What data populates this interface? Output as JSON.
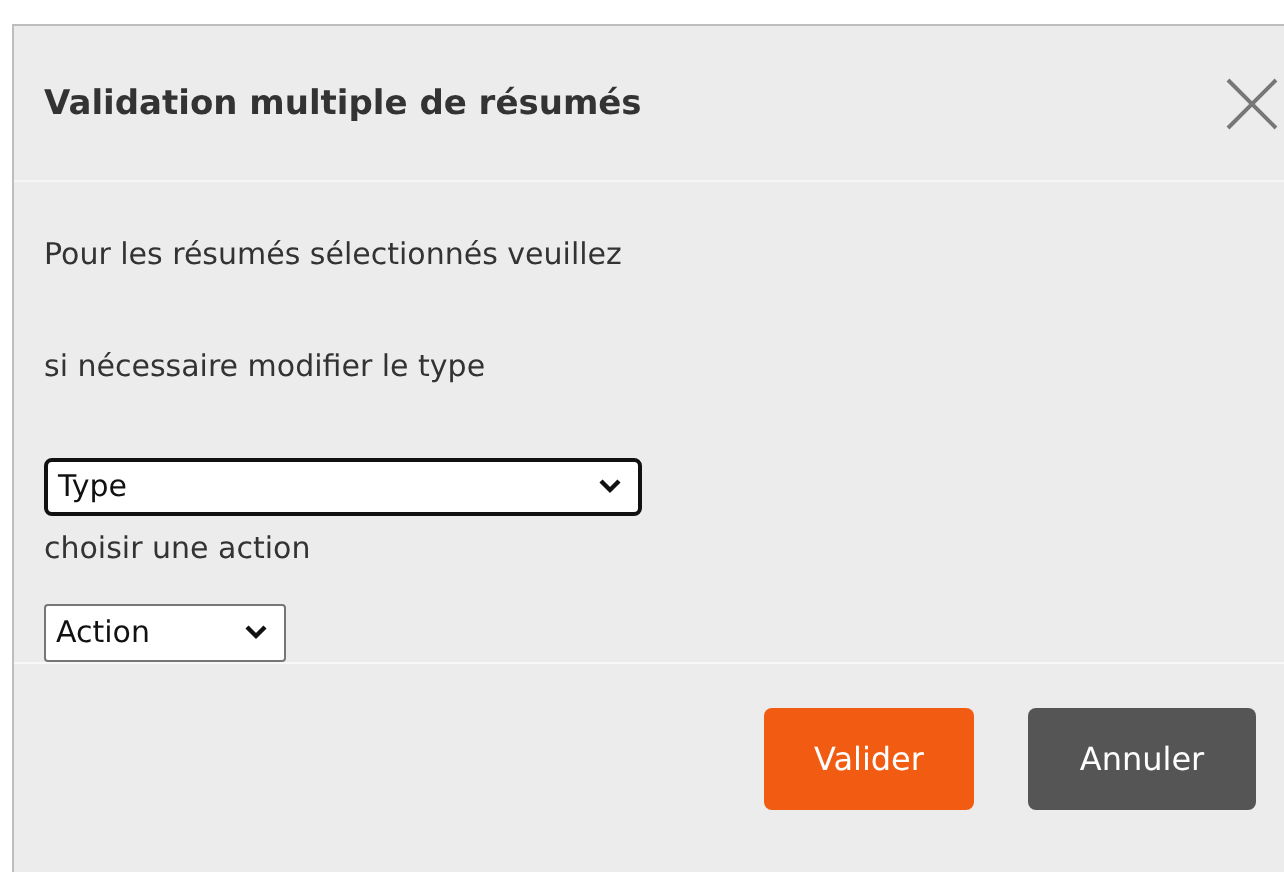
{
  "dialog": {
    "title": "Validation multiple de résumés",
    "body": [
      {
        "kind": "text",
        "text": "Pour les résumés sélectionnés veuillez"
      },
      {
        "kind": "text",
        "text": "si nécessaire modifier le type"
      },
      {
        "kind": "select",
        "value": "Type",
        "focused": true
      },
      {
        "kind": "label",
        "text": "choisir une action"
      },
      {
        "kind": "select",
        "value": "Action",
        "focused": false
      }
    ],
    "buttons": [
      {
        "label": "Valider",
        "kind": "primary"
      },
      {
        "label": "Annuler",
        "kind": "secondary"
      }
    ]
  }
}
